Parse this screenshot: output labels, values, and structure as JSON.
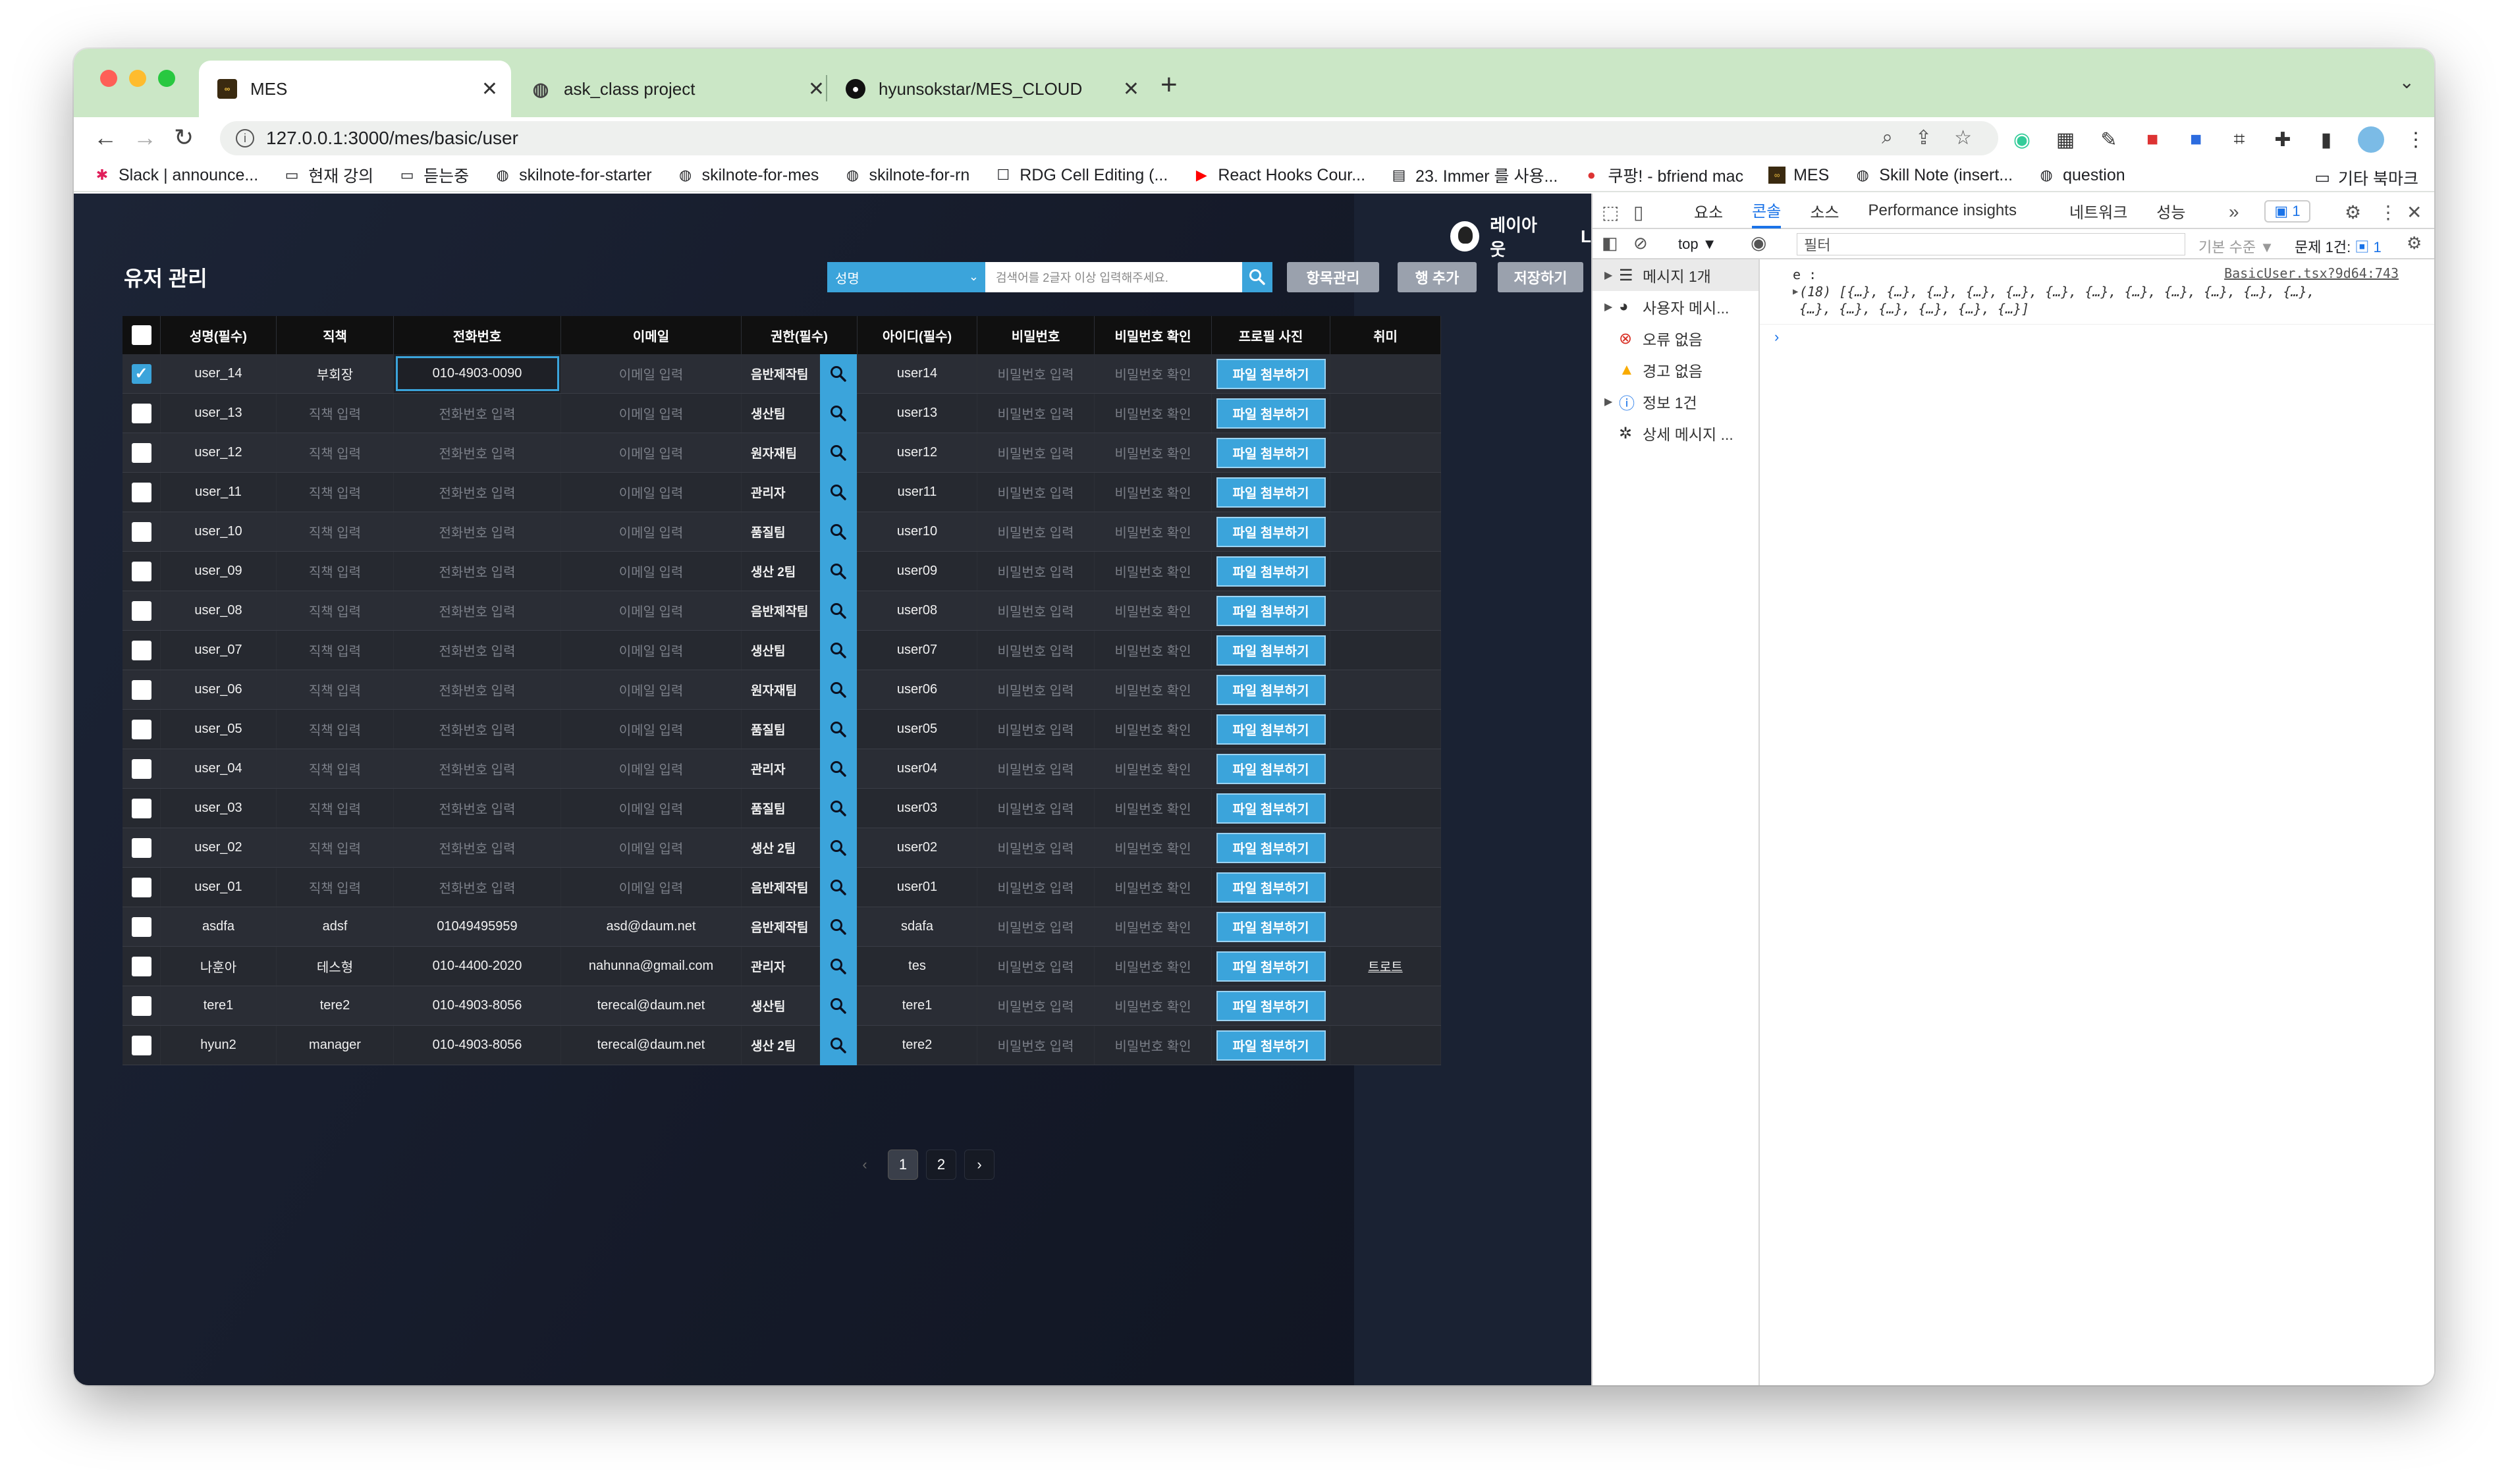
{
  "browser": {
    "tabs": [
      {
        "title": "MES",
        "active": true
      },
      {
        "title": "ask_class project",
        "active": false
      },
      {
        "title": "hyunsokstar/MES_CLOUD",
        "active": false
      }
    ],
    "url": "127.0.0.1:3000/mes/basic/user",
    "bookmarks": [
      "Slack | announce...",
      "현재 강의",
      "듣는중",
      "skilnote-for-starter",
      "skilnote-for-mes",
      "skilnote-for-rn",
      "RDG Cell Editing (...",
      "React Hooks Cour...",
      "23. Immer 를 사용...",
      "쿠팡! - bfriend mac",
      "MES",
      "Skill Note (insert...",
      "question"
    ],
    "other_bookmarks": "기타 북마크"
  },
  "app": {
    "user_name": "레이아웃",
    "more": "L",
    "page_title": "유저 관리",
    "search": {
      "select_value": "성명",
      "placeholder": "검색어를 2글자 이상 입력해주세요."
    },
    "buttons": {
      "manage": "항목관리",
      "add_row": "행 추가",
      "save": "저장하기"
    },
    "columns": [
      "성명(필수)",
      "직책",
      "전화번호",
      "이메일",
      "권한(필수)",
      "아이디(필수)",
      "비밀번호",
      "비밀번호 확인",
      "프로필 사진",
      "취미"
    ],
    "file_button": "파일 첨부하기",
    "placeholders": {
      "position": "직책 입력",
      "phone": "전화번호 입력",
      "email": "이메일 입력",
      "password": "비밀번호 입력",
      "password_confirm": "비밀번호 확인"
    },
    "rows": [
      {
        "checked": true,
        "name": "user_14",
        "position": "부회장",
        "phone": "010-4903-0090",
        "email": "",
        "role": "음반제작팀",
        "id": "user14",
        "hobby": ""
      },
      {
        "checked": false,
        "name": "user_13",
        "position": "",
        "phone": "",
        "email": "",
        "role": "생산팀",
        "id": "user13",
        "hobby": ""
      },
      {
        "checked": false,
        "name": "user_12",
        "position": "",
        "phone": "",
        "email": "",
        "role": "원자재팀",
        "id": "user12",
        "hobby": ""
      },
      {
        "checked": false,
        "name": "user_11",
        "position": "",
        "phone": "",
        "email": "",
        "role": "관리자",
        "id": "user11",
        "hobby": ""
      },
      {
        "checked": false,
        "name": "user_10",
        "position": "",
        "phone": "",
        "email": "",
        "role": "품질팀",
        "id": "user10",
        "hobby": ""
      },
      {
        "checked": false,
        "name": "user_09",
        "position": "",
        "phone": "",
        "email": "",
        "role": "생산 2팀",
        "id": "user09",
        "hobby": ""
      },
      {
        "checked": false,
        "name": "user_08",
        "position": "",
        "phone": "",
        "email": "",
        "role": "음반제작팀",
        "id": "user08",
        "hobby": ""
      },
      {
        "checked": false,
        "name": "user_07",
        "position": "",
        "phone": "",
        "email": "",
        "role": "생산팀",
        "id": "user07",
        "hobby": ""
      },
      {
        "checked": false,
        "name": "user_06",
        "position": "",
        "phone": "",
        "email": "",
        "role": "원자재팀",
        "id": "user06",
        "hobby": ""
      },
      {
        "checked": false,
        "name": "user_05",
        "position": "",
        "phone": "",
        "email": "",
        "role": "품질팀",
        "id": "user05",
        "hobby": ""
      },
      {
        "checked": false,
        "name": "user_04",
        "position": "",
        "phone": "",
        "email": "",
        "role": "관리자",
        "id": "user04",
        "hobby": ""
      },
      {
        "checked": false,
        "name": "user_03",
        "position": "",
        "phone": "",
        "email": "",
        "role": "품질팀",
        "id": "user03",
        "hobby": ""
      },
      {
        "checked": false,
        "name": "user_02",
        "position": "",
        "phone": "",
        "email": "",
        "role": "생산 2팀",
        "id": "user02",
        "hobby": ""
      },
      {
        "checked": false,
        "name": "user_01",
        "position": "",
        "phone": "",
        "email": "",
        "role": "음반제작팀",
        "id": "user01",
        "hobby": ""
      },
      {
        "checked": false,
        "name": "asdfa",
        "position": "adsf",
        "phone": "01049495959",
        "email": "asd@daum.net",
        "role": "음반제작팀",
        "id": "sdafa",
        "hobby": ""
      },
      {
        "checked": false,
        "name": "나훈아",
        "position": "테스형",
        "phone": "010-4400-2020",
        "email": "nahunna@gmail.com",
        "role": "관리자",
        "id": "tes",
        "hobby": "트로트"
      },
      {
        "checked": false,
        "name": "tere1",
        "position": "tere2",
        "phone": "010-4903-8056",
        "email": "terecal@daum.net",
        "role": "생산팀",
        "id": "tere1",
        "hobby": ""
      },
      {
        "checked": false,
        "name": "hyun2",
        "position": "manager",
        "phone": "010-4903-8056",
        "email": "terecal@daum.net",
        "role": "생산 2팀",
        "id": "tere2",
        "hobby": ""
      }
    ],
    "pagination": {
      "pages": [
        "1",
        "2"
      ],
      "current": "1"
    }
  },
  "devtools": {
    "tabs": [
      "요소",
      "콘솔",
      "소스",
      "Performance insights",
      "네트워크",
      "성능"
    ],
    "active_tab": "콘솔",
    "issues_badge": "1",
    "context": "top",
    "filter_placeholder": "필터",
    "level": "기본 수준 ▼",
    "issues_text": "문제 1건:",
    "issues_count": "1",
    "sidebar": [
      "메시지 1개",
      "사용자 메시...",
      "오류 없음",
      "경고 없음",
      "정보 1건",
      "상세 메시지 ..."
    ],
    "log": {
      "label": "e :",
      "source": "BasicUser.tsx?9d64:743",
      "line1": "(18) [{…}, {…}, {…}, {…}, {…}, {…}, {…}, {…}, {…}, {…}, {…}, {…},",
      "line2": "{…}, {…}, {…}, {…}, {…}, {…}]"
    }
  }
}
